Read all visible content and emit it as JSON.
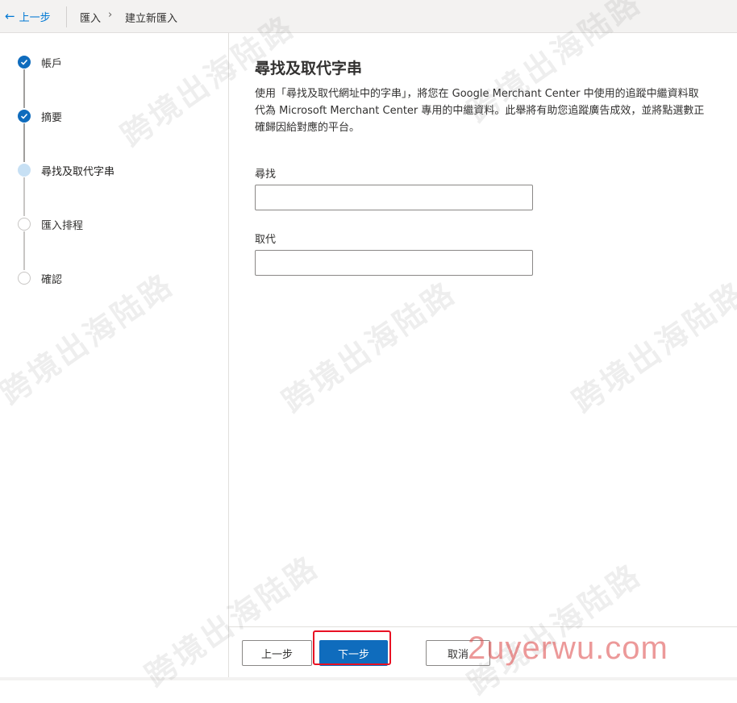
{
  "topbar": {
    "back_label": "上一步",
    "back_icon": "arrow-left-icon",
    "breadcrumb": [
      "匯入",
      "建立新匯入"
    ],
    "separator_icon": "chevron-right-icon"
  },
  "steps": [
    {
      "label": "帳戶",
      "state": "done"
    },
    {
      "label": "摘要",
      "state": "done"
    },
    {
      "label": "尋找及取代字串",
      "state": "current"
    },
    {
      "label": "匯入排程",
      "state": "todo"
    },
    {
      "label": "確認",
      "state": "todo"
    }
  ],
  "main": {
    "title": "尋找及取代字串",
    "description": "使用「尋找及取代網址中的字串」，將您在 Google Merchant Center 中使用的追蹤中繼資料取代為 Microsoft Merchant Center 專用的中繼資料。此舉將有助您追蹤廣告成效，並將點選數正確歸因給對應的平台。",
    "find": {
      "label": "尋找",
      "value": "",
      "placeholder": ""
    },
    "replace": {
      "label": "取代",
      "value": "",
      "placeholder": ""
    }
  },
  "footer": {
    "prev_label": "上一步",
    "next_label": "下一步",
    "cancel_label": "取消"
  },
  "watermark": {
    "text": "跨境出海陆路",
    "site": "2uyerwu.com"
  },
  "colors": {
    "accent": "#0f6cbd",
    "highlight": "#e81123",
    "current_step": "#c7e0f4"
  }
}
